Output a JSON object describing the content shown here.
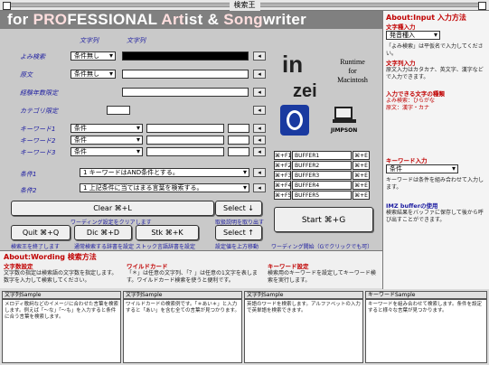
{
  "window": {
    "title": "検索王"
  },
  "banner": {
    "prefix": "for ",
    "pro": "PRO",
    "fessional": "FESSIONAL ",
    "art": "Art",
    "ist": "ist & ",
    "song": "Song",
    "writer": "writer"
  },
  "headers": {
    "mode": "文字列",
    "string": "文字列"
  },
  "rows": [
    {
      "label": "よみ検索",
      "mode": "条件無し"
    },
    {
      "label": "原文",
      "mode": "条件無し"
    },
    {
      "label": "経験年数限定",
      "mode": ""
    },
    {
      "label": "カテゴリ限定",
      "mode": ""
    },
    {
      "label": "キーワード1",
      "mode": "条件"
    },
    {
      "label": "キーワード2",
      "mode": "条件"
    },
    {
      "label": "キーワード3",
      "mode": "条件"
    }
  ],
  "conditions": [
    {
      "label": "条件1",
      "value": "1 キーワードはAND条件とする。"
    },
    {
      "label": "条件2",
      "value": "1 上記条件に当てはまる言葉を検索する。"
    }
  ],
  "logo": {
    "in": "in",
    "zei": "zei",
    "runtime": "Runtime",
    "for": "for",
    "mac": "Macintosh",
    "jimpson": "JIMPSON"
  },
  "buffers": [
    {
      "key": "⌘+F1",
      "name": "BUFFER1",
      "shortcut": "⌘+E"
    },
    {
      "key": "⌘+F2",
      "name": "BUFFER2",
      "shortcut": "⌘+E"
    },
    {
      "key": "⌘+F3",
      "name": "BUFFER3",
      "shortcut": "⌘+E"
    },
    {
      "key": "⌘+F4",
      "name": "BUFFER4",
      "shortcut": "⌘+E"
    },
    {
      "key": "⌘+F5",
      "name": "BUFFER5",
      "shortcut": "⌘+E"
    }
  ],
  "buttons": {
    "clear": "Clear ⌘+L",
    "clear_note": "ワーディング設定をクリアします",
    "select1": "Select ↓",
    "select1_note": "取扱説明を取り出す",
    "quit": "Quit ⌘+Q",
    "quit_note": "検索王を終了します",
    "dic": "Dic ⌘+D",
    "dic_note": "通常検索する辞書を設定",
    "stk": "Stk ⌘+K",
    "stk_note": "ストック言語辞書を設定",
    "select2": "Select ↑",
    "select2_note": "設定値を上方移動",
    "start": "Start ⌘+G",
    "start_note": "ワーディング開始（Gでクリックでも可）"
  },
  "about_wording": {
    "title": "About:Wording 検索方法",
    "sections": [
      {
        "head": "文字数設定",
        "text": "文字数の指定は検索語の文字数を指定します。数字を入力して検索してください。"
      },
      {
        "head": "ワイルドカード",
        "text": "「＊」は任意の文字列、「？」は任意の1文字を表します。ワイルドカード検索を使うと便利です。"
      },
      {
        "head": "キーワード設定",
        "text": "検索用のキーワードを設定してキーワード検索を実行します。"
      }
    ]
  },
  "samples": [
    {
      "head": "文字列Sample",
      "text": "メロディ歌詞などのイメージに合わせた言葉を検索します。例えば「～な」「～も」を入力すると条件に合う言葉を検索します。"
    },
    {
      "head": "文字列Sample",
      "text": "ワイルドカードの検索例です。「＊あい＊」と入力すると「あい」を含む全ての言葉が見つかります。"
    },
    {
      "head": "文字列Sample",
      "text": "英語のワードを検索します。アルファベットの入力で英単語を検索できます。"
    },
    {
      "head": "キーワードSample",
      "text": "キーワードを組み合わせて検索します。条件を設定すると様々な言葉が見つかります。"
    }
  ],
  "right": {
    "about_input": "About:Input 入力方法",
    "input_type": "文字種入力",
    "input_select": "発音種入",
    "texts": [
      "「よみ検索」は平仮名で入力してください。",
      "文字列入力",
      "原文入力はカタカナ、英文字、漢字などで入力できます。",
      "入力できる文字の種類",
      "よみ検索：ひらがな",
      "原文：漢字・カナ",
      "キーワード入力",
      "キーワードは条件を組み合わせて入力します。"
    ],
    "kw_select": "条件",
    "buffer_title": "IMZ bufferの使用",
    "buffer_text": "検索結果をバッファに保存して後から呼び出すことができます。"
  }
}
